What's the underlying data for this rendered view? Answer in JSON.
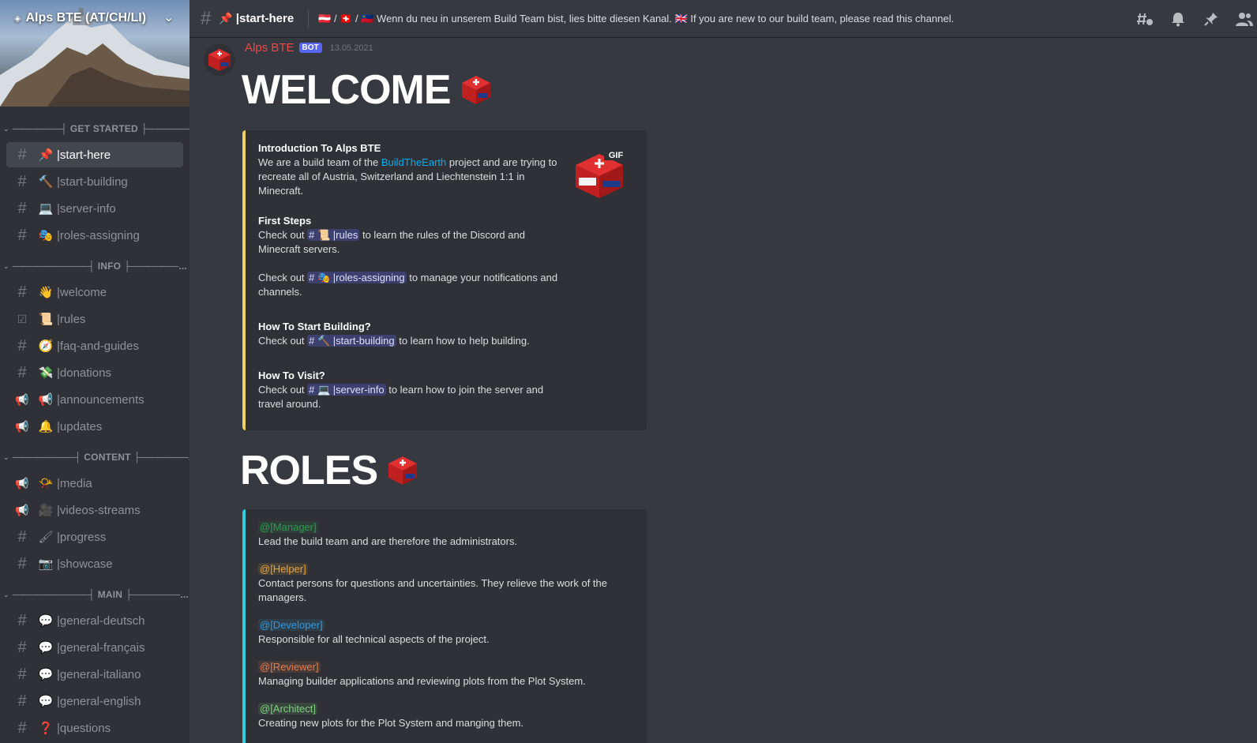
{
  "server": {
    "name": "Alps BTE (AT/CH/LI)",
    "chevron": "chevron-down-icon"
  },
  "sidebar": {
    "categories": [
      {
        "label": "───────┤ GET STARTED ├───────...",
        "channels": [
          {
            "icon": "#",
            "emoji": "📌",
            "name": "|start-here",
            "active": true
          },
          {
            "icon": "#",
            "emoji": "🔨",
            "name": "|start-building"
          },
          {
            "icon": "#",
            "emoji": "💻",
            "name": "|server-info"
          },
          {
            "icon": "#",
            "emoji": "🎭",
            "name": "|roles-assigning"
          }
        ]
      },
      {
        "label": "───────────┤ INFO ├───────...",
        "channels": [
          {
            "icon": "#",
            "emoji": "👋",
            "name": "|welcome"
          },
          {
            "icon": "☑",
            "emoji": "📜",
            "name": "|rules"
          },
          {
            "icon": "#",
            "emoji": "🧭",
            "name": "|faq-and-guides"
          },
          {
            "icon": "#",
            "emoji": "💸",
            "name": "|donations"
          },
          {
            "icon": "📢",
            "emoji": "📢",
            "name": "|announcements"
          },
          {
            "icon": "📢",
            "emoji": "🔔",
            "name": "|updates"
          }
        ]
      },
      {
        "label": "─────────┤ CONTENT ├───────...",
        "channels": [
          {
            "icon": "📢",
            "emoji": "📯",
            "name": "|media"
          },
          {
            "icon": "📢",
            "emoji": "🎥",
            "name": "|videos-streams"
          },
          {
            "icon": "#",
            "emoji": "🖌",
            "name": "|progress"
          },
          {
            "icon": "#",
            "emoji": "📷",
            "name": "|showcase"
          }
        ]
      },
      {
        "label": "───────────┤ MAIN ├───────...",
        "channels": [
          {
            "icon": "#",
            "emoji": "💬",
            "name": "|general-deutsch"
          },
          {
            "icon": "#",
            "emoji": "💬",
            "name": "|general-français"
          },
          {
            "icon": "#",
            "emoji": "💬",
            "name": "|general-italiano"
          },
          {
            "icon": "#",
            "emoji": "💬",
            "name": "|general-english"
          },
          {
            "icon": "#",
            "emoji": "❓",
            "name": "|questions"
          }
        ]
      }
    ]
  },
  "header": {
    "channel_emoji": "📌",
    "channel_name": "|start-here",
    "topic_flags": "🇦🇹 / 🇨🇭 / 🇱🇮",
    "topic_de": "Wenn du neu in unserem Build Team bist, lies bitte diesen Kanal.",
    "topic_flag_en": "🇬🇧",
    "topic_en": "If you are new to our build team, please read this channel.",
    "icons": [
      "threads-icon",
      "bell-icon",
      "pin-icon",
      "members-icon"
    ]
  },
  "message": {
    "author": "Alps BTE",
    "bot_tag": "BOT",
    "timestamp": "13.05.2021",
    "welcome_title": "WELCOME",
    "roles_title": "ROLES"
  },
  "welcome_embed": {
    "gif_label": "GIF",
    "intro_title": "Introduction To Alps BTE",
    "intro_text_1": "We are a build team of the ",
    "intro_link": "BuildTheEarth",
    "intro_text_2": " project and are trying to recreate all of Austria, Switzerland and Liechtenstein 1:1 in Minecraft.",
    "first_steps_title": "First Steps",
    "check_out": "Check out ",
    "rules_mention": "# 📜 |rules",
    "rules_text": " to learn the rules of the Discord and Minecraft servers.",
    "roles_mention": "# 🎭 |roles-assigning",
    "roles_text": " to manage your notifications and channels.",
    "start_title": "How To Start Building?",
    "building_mention": "# 🔨 |start-building",
    "building_text": " to learn how to help building.",
    "visit_title": "How To Visit?",
    "server_mention": "# 💻 |server-info",
    "server_text": " to learn how to join the server and travel around."
  },
  "roles_embed": {
    "roles": [
      {
        "mention": "@[Manager]",
        "color": "#2e9b4f",
        "text": "Lead the build team and are therefore the administrators."
      },
      {
        "mention": "@[Helper]",
        "color": "#e8a33b",
        "text": "Contact persons for questions and uncertainties. They relieve the work of the managers."
      },
      {
        "mention": "@[Developer]",
        "color": "#3498db",
        "text": "Responsible for all technical aspects of the project."
      },
      {
        "mention": "@[Reviewer]",
        "color": "#e67e4f",
        "text": "Managing builder applications and reviewing plots from the Plot System."
      },
      {
        "mention": "@[Architect]",
        "color": "#7ed07e",
        "text": "Creating new plots for the Plot System and manging them."
      }
    ]
  },
  "colors": {
    "accent_welcome": "#f0d060",
    "accent_roles": "#2ecfe0",
    "author": "#f04747"
  }
}
